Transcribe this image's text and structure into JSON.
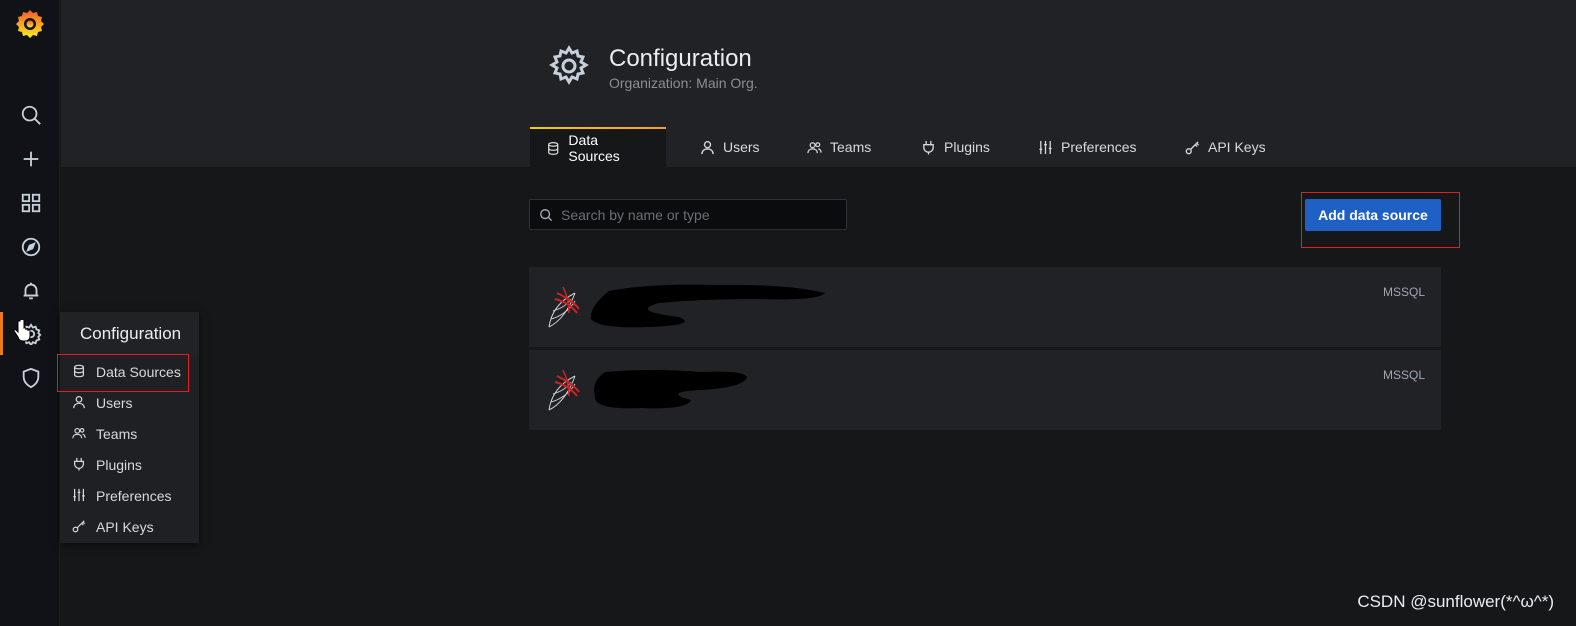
{
  "sidebar": {
    "icons": [
      "grafana-logo-icon",
      "search-icon",
      "plus-icon",
      "dashboards-icon",
      "explore-icon",
      "alerting-icon",
      "configuration-icon",
      "shield-icon"
    ]
  },
  "flyout": {
    "title": "Configuration",
    "items": [
      {
        "label": "Data Sources",
        "icon": "database-icon"
      },
      {
        "label": "Users",
        "icon": "user-icon"
      },
      {
        "label": "Teams",
        "icon": "teams-icon"
      },
      {
        "label": "Plugins",
        "icon": "plug-icon"
      },
      {
        "label": "Preferences",
        "icon": "sliders-icon"
      },
      {
        "label": "API Keys",
        "icon": "key-icon"
      }
    ]
  },
  "page": {
    "title": "Configuration",
    "subtitle": "Organization: Main Org."
  },
  "tabs": [
    {
      "label": "Data Sources",
      "icon": "database-icon",
      "active": true
    },
    {
      "label": "Users",
      "icon": "user-icon"
    },
    {
      "label": "Teams",
      "icon": "teams-icon"
    },
    {
      "label": "Plugins",
      "icon": "plug-icon"
    },
    {
      "label": "Preferences",
      "icon": "sliders-icon"
    },
    {
      "label": "API Keys",
      "icon": "key-icon"
    }
  ],
  "search": {
    "placeholder": "Search by name or type",
    "value": ""
  },
  "add_button": "Add data source",
  "datasources": [
    {
      "type": "MSSQL",
      "logo": "sql-server-icon",
      "name_redacted": true
    },
    {
      "type": "MSSQL",
      "logo": "sql-server-icon",
      "name_redacted": true
    }
  ],
  "watermark": "CSDN @sunflower(*^ω^*)",
  "colors": {
    "accent": "#eb7b18",
    "primary_button": "#1f60c4",
    "highlight_box": "#e02020"
  }
}
